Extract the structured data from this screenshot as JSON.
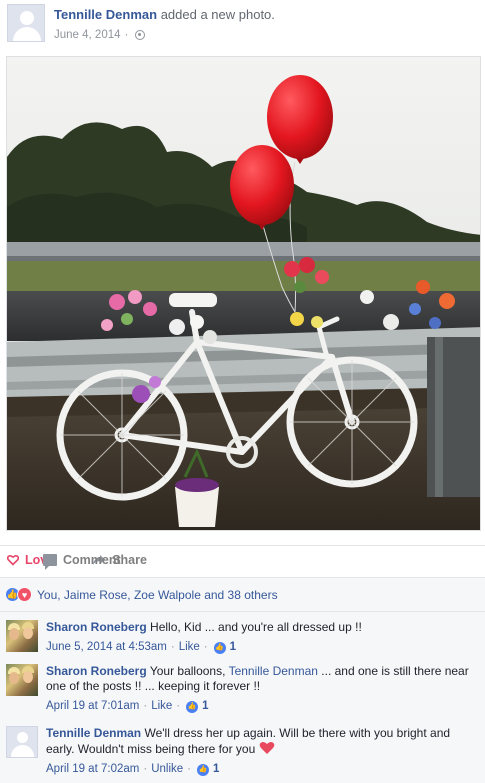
{
  "post": {
    "author": "Tennille Denman",
    "action": "added a new photo.",
    "date": "June 4, 2014",
    "privacy_icon": "globe-icon"
  },
  "actions": {
    "love": "Love",
    "comment": "Comment",
    "share": "Share"
  },
  "reactions": {
    "summary": "You, Jaime Rose, Zoe Walpole and 38 others"
  },
  "comments": [
    {
      "name": "Sharon Roneberg",
      "text": "Hello, Kid ... and you're all dressed up !!",
      "time": "June 5, 2014 at 4:53am",
      "like_label": "Like",
      "likes": "1"
    },
    {
      "name": "Sharon Roneberg",
      "text_before": "Your balloons,",
      "mention": "Tennille Denman",
      "text_after": "... and one is still there near one of the posts !! ... keeping it forever !!",
      "time": "April 19 at 7:01am",
      "like_label": "Like",
      "likes": "1"
    },
    {
      "name": "Tennille Denman",
      "text": "We'll dress her up again. Will be there with you bright and early. Wouldn't miss being there for you",
      "time": "April 19 at 7:02am",
      "like_label": "Unlike",
      "likes": "1"
    }
  ],
  "colors": {
    "link": "#365899",
    "love": "#e9446a",
    "balloon": "#e3161f"
  }
}
